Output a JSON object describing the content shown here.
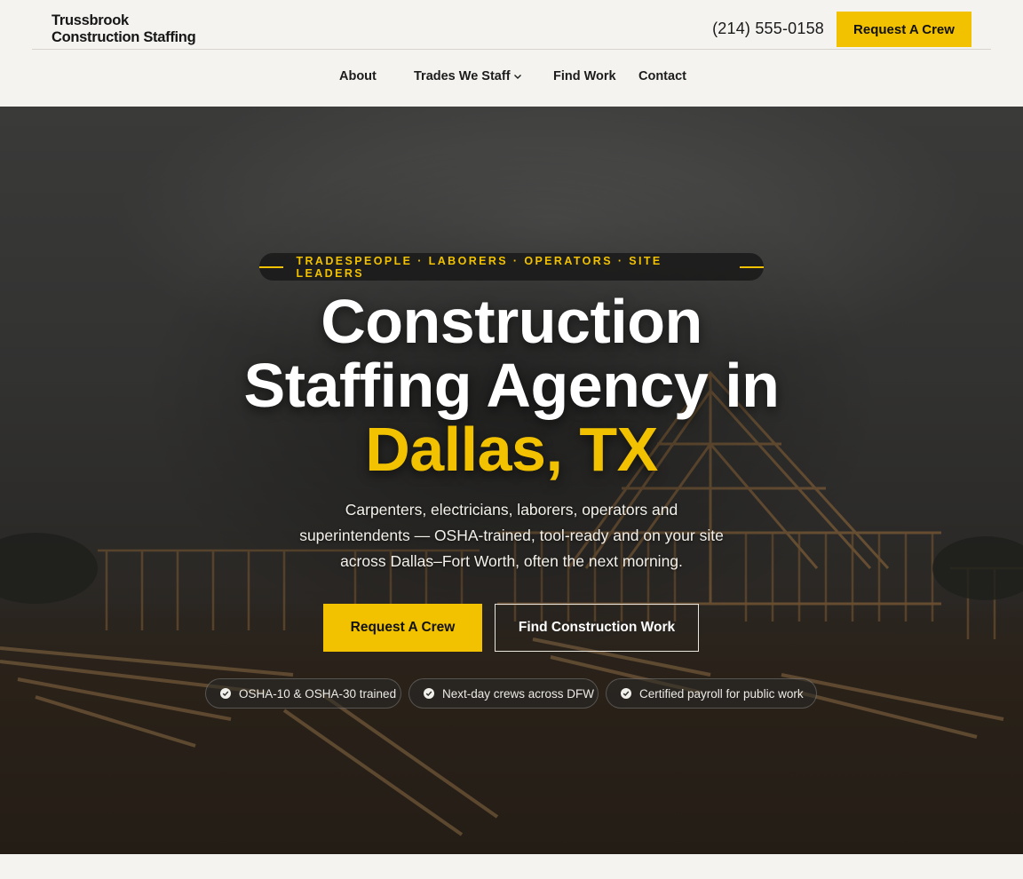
{
  "header": {
    "logo_line1": "Trussbrook",
    "logo_line2": "Construction Staffing",
    "phone": "(214) 555-0158",
    "cta_label": "Request A Crew"
  },
  "nav": {
    "items": [
      {
        "label": "About"
      },
      {
        "label": "Trades We Staff",
        "icon": "chevron-down-icon"
      },
      {
        "label": "Find Work"
      },
      {
        "label": "Contact"
      }
    ]
  },
  "hero": {
    "eyebrow": "TRADESPEOPLE · LABORERS · OPERATORS · SITE LEADERS",
    "title_line1": "Construction",
    "title_line2": "Staffing Agency in",
    "title_accent": "Dallas, TX",
    "lede": "Carpenters, electricians, laborers, operators and superintendents — OSHA-trained, tool-ready and on your site across Dallas–Fort Worth, often the next morning.",
    "primary_cta": "Request A Crew",
    "secondary_cta": "Find Construction Work",
    "badges": [
      {
        "label": "OSHA-10 & OSHA-30 trained",
        "icon": "check-circle-icon"
      },
      {
        "label": "Next-day crews across DFW",
        "icon": "check-circle-icon"
      },
      {
        "label": "Certified payroll for public work",
        "icon": "check-circle-icon"
      }
    ]
  },
  "colors": {
    "accent": "#f2c200",
    "page_bg": "#f4f3ef",
    "text_dark": "#1a1a1a"
  }
}
